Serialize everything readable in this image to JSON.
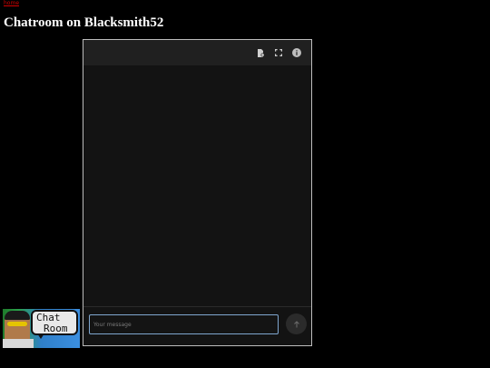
{
  "header": {
    "top_link": "home",
    "title": "Chatroom on Blacksmith52"
  },
  "chat": {
    "toolbar": {
      "buttons": [
        "settings-doc-icon",
        "fullscreen-icon",
        "info-icon"
      ]
    },
    "input": {
      "placeholder": "Your message",
      "value": ""
    },
    "send_icon": "arrow-up-icon"
  },
  "banner": {
    "line1": "Chat",
    "line2": "Room"
  },
  "colors": {
    "background": "#000000",
    "chat_bg": "#131313",
    "toolbar_bg": "#202020",
    "input_border": "#7fa6cf",
    "link": "#d40000"
  }
}
